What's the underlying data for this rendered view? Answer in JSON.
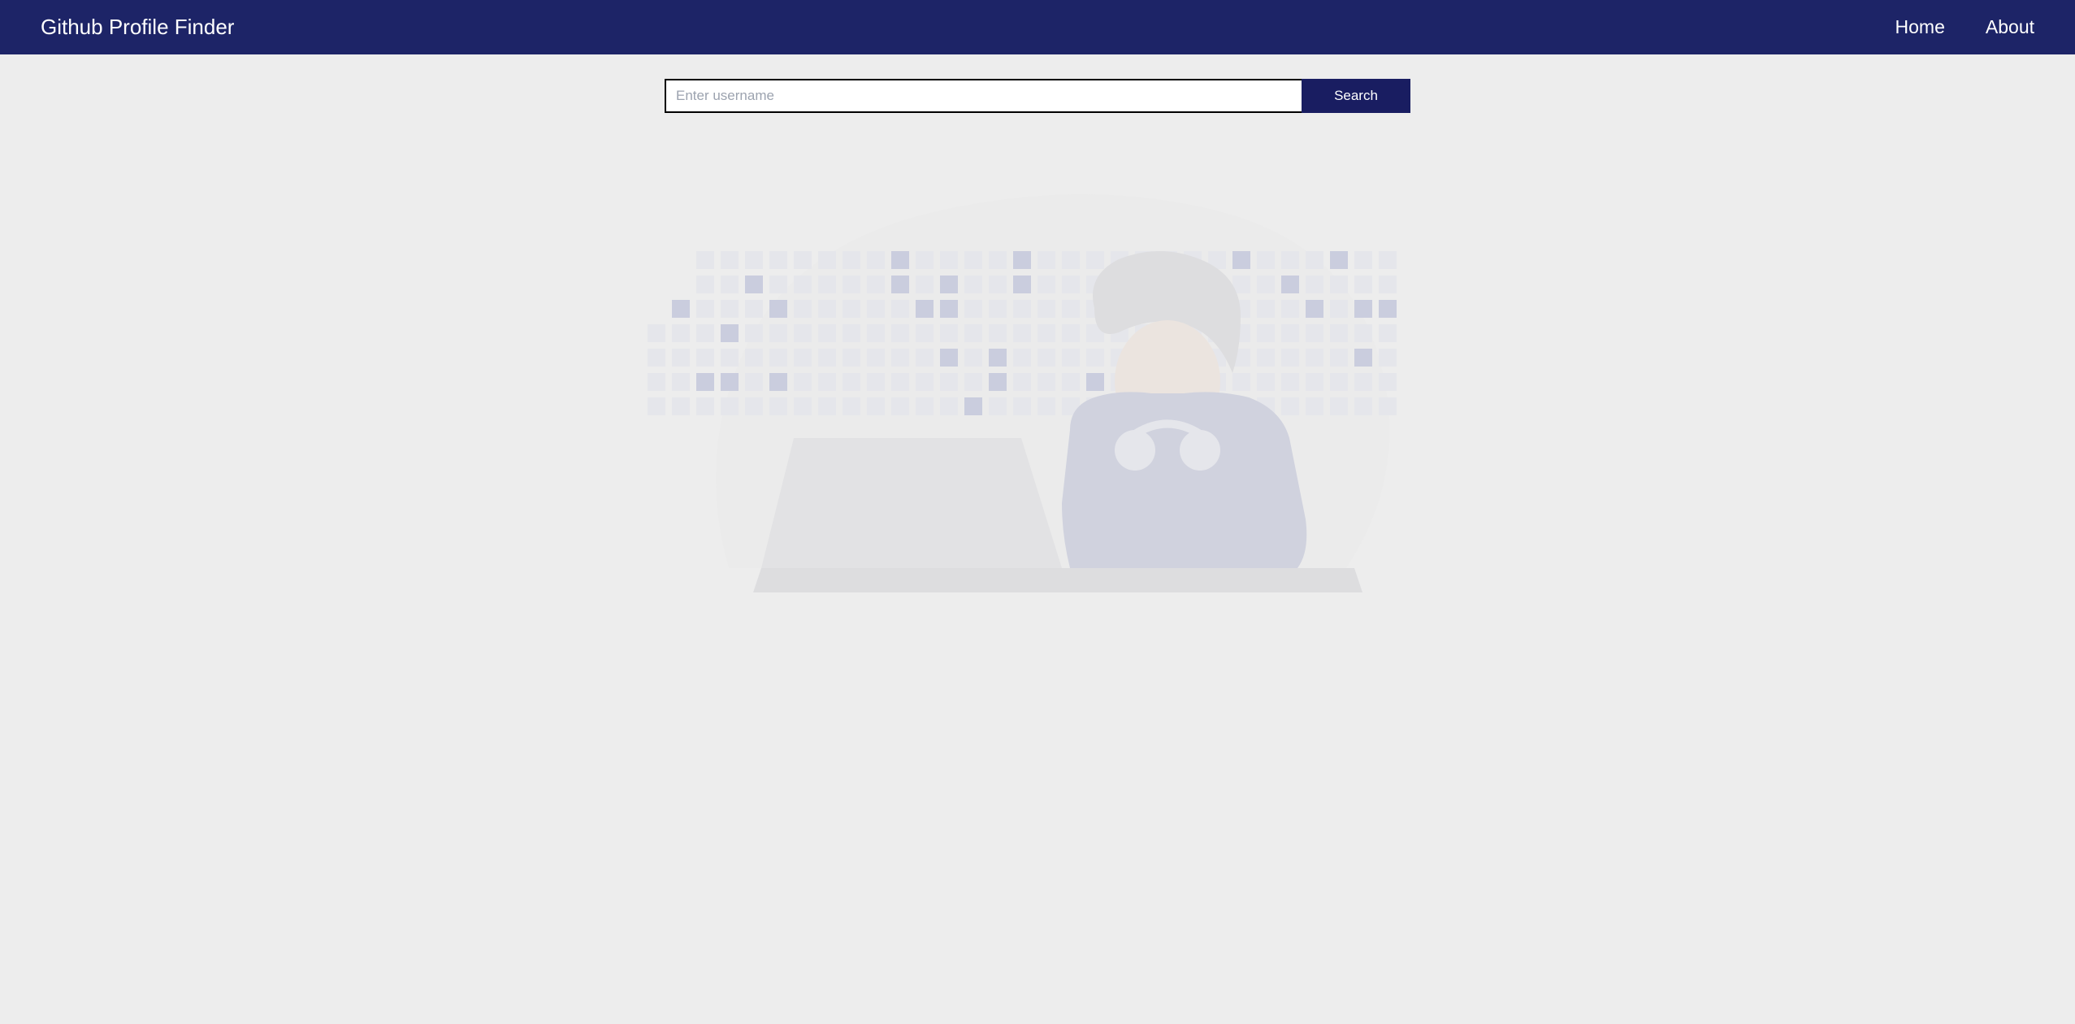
{
  "navbar": {
    "title": "Github Profile Finder",
    "links": {
      "home": "Home",
      "about": "About"
    }
  },
  "search": {
    "placeholder": "Enter username",
    "value": "",
    "button_label": "Search"
  },
  "colors": {
    "navbar_bg": "#1d2467",
    "button_bg": "#191d61",
    "page_bg": "#ededed"
  }
}
